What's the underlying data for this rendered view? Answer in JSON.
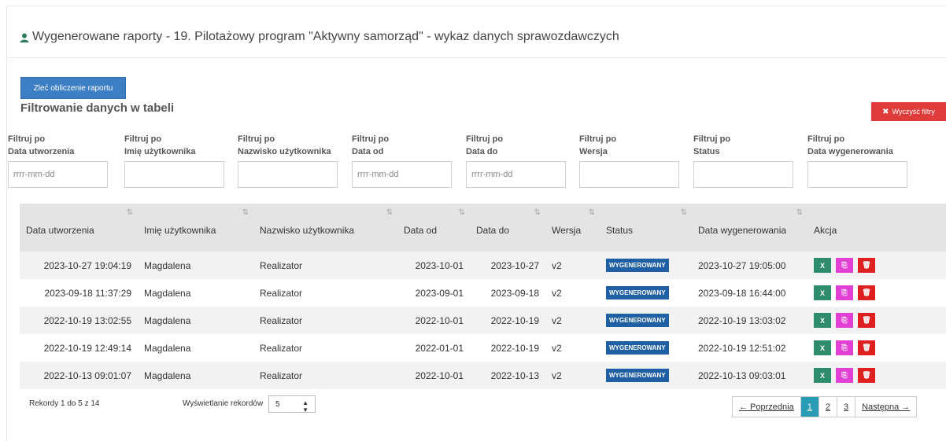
{
  "panel": {
    "title": "Wygenerowane raporty - 19. Pilotażowy program \"Aktywny samorząd\" - wykaz danych sprawozdawczych",
    "icon": "user-icon"
  },
  "buttons": {
    "order": "Zleć obliczenie raportu",
    "clear": "Wyczyść filtry"
  },
  "filter_title": "Filtrowanie danych w tabeli",
  "filters": [
    {
      "line1": "Filtruj po",
      "line2": "Data utworzenia",
      "placeholder": "rrrr-mm-dd"
    },
    {
      "line1": "Filtruj po",
      "line2": "Imię użytkownika",
      "placeholder": ""
    },
    {
      "line1": "Filtruj po",
      "line2": "Nazwisko użytkownika",
      "placeholder": ""
    },
    {
      "line1": "Filtruj po",
      "line2": "Data od",
      "placeholder": "rrrr-mm-dd"
    },
    {
      "line1": "Filtruj po",
      "line2": "Data do",
      "placeholder": "rrrr-mm-dd"
    },
    {
      "line1": "Filtruj po",
      "line2": "Wersja",
      "placeholder": ""
    },
    {
      "line1": "Filtruj po",
      "line2": "Status",
      "placeholder": ""
    },
    {
      "line1": "Filtruj po",
      "line2": "Data wygenerowania",
      "placeholder": ""
    }
  ],
  "table": {
    "headers": [
      "Data utworzenia",
      "Imię użytkownika",
      "Nazwisko użytkownika",
      "Data od",
      "Data do",
      "Wersja",
      "Status",
      "Data wygenerowania",
      "Akcja"
    ],
    "rows": [
      [
        "2023-10-27 19:04:19",
        "Magdalena",
        "Realizator",
        "2023-10-01",
        "2023-10-27",
        "v2",
        "WYGENEROWANY",
        "2023-10-27 19:05:00"
      ],
      [
        "2023-09-18 11:37:29",
        "Magdalena",
        "Realizator",
        "2023-09-01",
        "2023-09-18",
        "v2",
        "WYGENEROWANY",
        "2023-09-18 16:44:00"
      ],
      [
        "2022-10-19 13:02:55",
        "Magdalena",
        "Realizator",
        "2022-10-01",
        "2022-10-19",
        "v2",
        "WYGENEROWANY",
        "2022-10-19 13:03:02"
      ],
      [
        "2022-10-19 12:49:14",
        "Magdalena",
        "Realizator",
        "2022-01-01",
        "2022-10-19",
        "v2",
        "WYGENEROWANY",
        "2022-10-19 12:51:02"
      ],
      [
        "2022-10-13 09:01:07",
        "Magdalena",
        "Realizator",
        "2022-10-01",
        "2022-10-13",
        "v2",
        "WYGENEROWANY",
        "2022-10-13 09:03:01"
      ]
    ]
  },
  "footer": {
    "records_info": "Rekordy 1 do 5 z 14",
    "records_show_label": "Wyświetlanie rekordów",
    "page_size": "5"
  },
  "pagination": {
    "prev": "← Poprzednia",
    "pages": [
      "1",
      "2",
      "3"
    ],
    "active": "1",
    "next": "Następna →"
  },
  "colors": {
    "primary": "#3d7fc4",
    "danger": "#e03b3b",
    "badge": "#1f5fa3",
    "excel": "#2e8b6b",
    "pdf": "#e23fd4",
    "delete": "#e02020",
    "page_active": "#2a9bb5"
  }
}
